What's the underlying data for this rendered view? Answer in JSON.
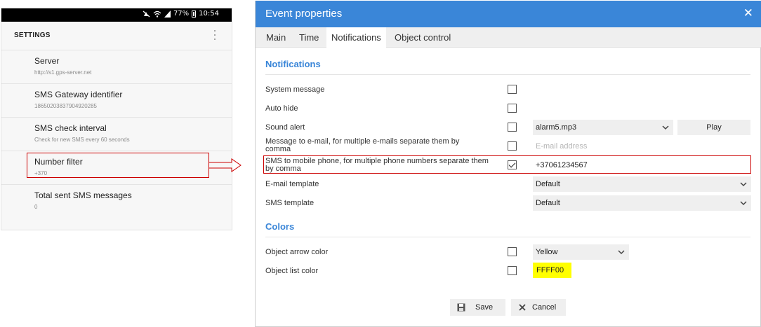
{
  "phone": {
    "status": {
      "battery": "77%",
      "time": "10:54"
    },
    "header": "SETTINGS",
    "items": [
      {
        "label": "Server",
        "sub": "http://s1.gps-server.net"
      },
      {
        "label": "SMS Gateway identifier",
        "sub": "18650203837904920285"
      },
      {
        "label": "SMS check interval",
        "sub": "Check for new SMS every 60 seconds"
      },
      {
        "label": "Number filter",
        "sub": "+370"
      },
      {
        "label": "Total sent SMS messages",
        "sub": "0"
      }
    ]
  },
  "dialog": {
    "title": "Event properties",
    "tabs": [
      "Main",
      "Time",
      "Notifications",
      "Object control"
    ],
    "active_tab": "Notifications",
    "sections": {
      "notifications": "Notifications",
      "colors": "Colors"
    },
    "rows": {
      "system_message": {
        "label": "System message",
        "checked": false
      },
      "auto_hide": {
        "label": "Auto hide",
        "checked": false
      },
      "sound_alert": {
        "label": "Sound alert",
        "checked": false,
        "select": "alarm5.mp3",
        "button": "Play"
      },
      "email": {
        "label": "Message to e-mail, for multiple e-mails separate them by comma",
        "checked": false,
        "placeholder": "E-mail address"
      },
      "sms": {
        "label": "SMS to mobile phone, for multiple phone numbers separate them by comma",
        "checked": true,
        "value": "+37061234567"
      },
      "email_template": {
        "label": "E-mail template",
        "select": "Default"
      },
      "sms_template": {
        "label": "SMS template",
        "select": "Default"
      },
      "arrow_color": {
        "label": "Object arrow color",
        "checked": false,
        "select": "Yellow"
      },
      "list_color": {
        "label": "Object list color",
        "checked": false,
        "value": "FFFF00"
      }
    },
    "buttons": {
      "save": "Save",
      "cancel": "Cancel"
    },
    "colors": {
      "titlebar": "#3a86d8",
      "highlight": "#cc0000",
      "swatch": "#ffff00"
    }
  }
}
